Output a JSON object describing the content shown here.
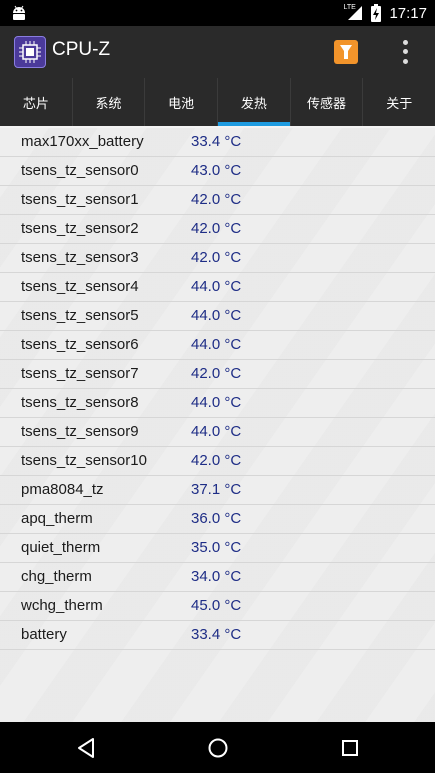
{
  "status": {
    "time": "17:17",
    "network": "LTE"
  },
  "app": {
    "title": "CPU-Z"
  },
  "tabs": [
    {
      "label": "芯片",
      "active": false
    },
    {
      "label": "系统",
      "active": false
    },
    {
      "label": "电池",
      "active": false
    },
    {
      "label": "发热",
      "active": true
    },
    {
      "label": "传感器",
      "active": false
    },
    {
      "label": "关于",
      "active": false
    }
  ],
  "thermal": [
    {
      "name": "max170xx_battery",
      "value": "33.4 °C"
    },
    {
      "name": "tsens_tz_sensor0",
      "value": "43.0 °C"
    },
    {
      "name": "tsens_tz_sensor1",
      "value": "42.0 °C"
    },
    {
      "name": "tsens_tz_sensor2",
      "value": "42.0 °C"
    },
    {
      "name": "tsens_tz_sensor3",
      "value": "42.0 °C"
    },
    {
      "name": "tsens_tz_sensor4",
      "value": "44.0 °C"
    },
    {
      "name": "tsens_tz_sensor5",
      "value": "44.0 °C"
    },
    {
      "name": "tsens_tz_sensor6",
      "value": "44.0 °C"
    },
    {
      "name": "tsens_tz_sensor7",
      "value": "42.0 °C"
    },
    {
      "name": "tsens_tz_sensor8",
      "value": "44.0 °C"
    },
    {
      "name": "tsens_tz_sensor9",
      "value": "44.0 °C"
    },
    {
      "name": "tsens_tz_sensor10",
      "value": "42.0 °C"
    },
    {
      "name": "pma8084_tz",
      "value": "37.1 °C"
    },
    {
      "name": "apq_therm",
      "value": "36.0 °C"
    },
    {
      "name": "quiet_therm",
      "value": "35.0 °C"
    },
    {
      "name": "chg_therm",
      "value": "34.0 °C"
    },
    {
      "name": "wchg_therm",
      "value": "45.0 °C"
    },
    {
      "name": "battery",
      "value": "33.4 °C"
    }
  ],
  "icons": {
    "status_left": "android-icon",
    "signal": "signal-icon",
    "battery": "battery-charging-icon",
    "share": "share-icon",
    "menu": "more-vert-icon",
    "nav_back": "back-icon",
    "nav_home": "home-icon",
    "nav_recent": "recent-apps-icon"
  },
  "colors": {
    "app_bar": "#2a2a2a",
    "tab_indicator": "#1e9be0",
    "value_text": "#1e2d86",
    "share_button": "#f2942b"
  }
}
